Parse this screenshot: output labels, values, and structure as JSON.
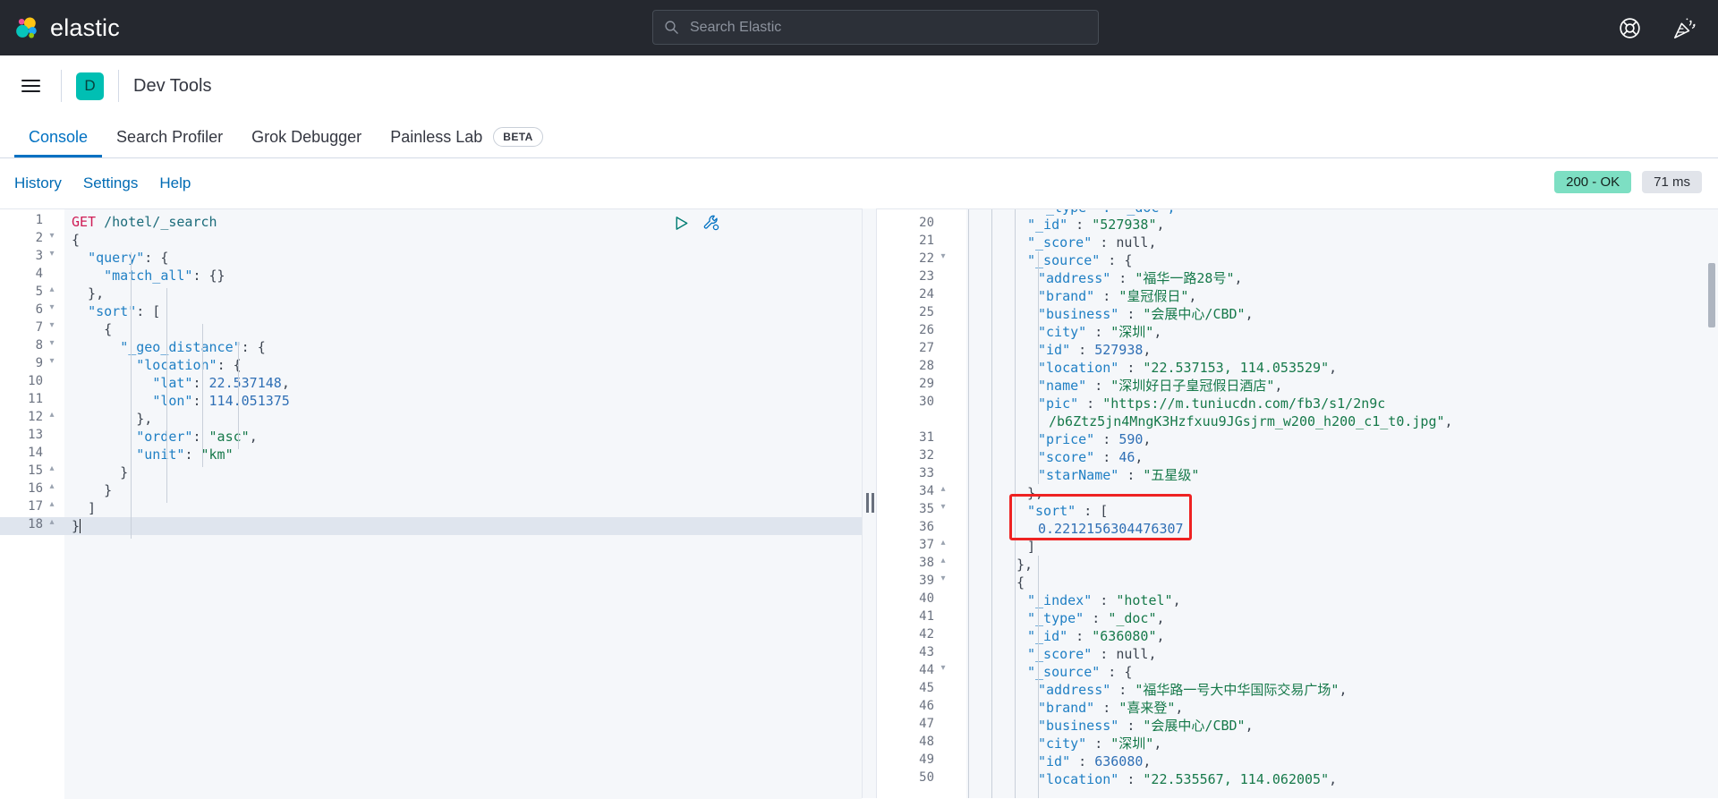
{
  "header": {
    "brand_name": "elastic",
    "search": {
      "placeholder": "Search Elastic",
      "value": "",
      "icon": "search-icon"
    },
    "icons": [
      {
        "name": "help-lifebuoy-icon",
        "label": "Help"
      },
      {
        "name": "news-confetti-icon",
        "label": "News"
      }
    ]
  },
  "breadcrumb": {
    "menu_icon": "hamburger-menu-icon",
    "space_initial": "D",
    "title": "Dev Tools"
  },
  "tabs": [
    {
      "label": "Console",
      "active": true,
      "badge": ""
    },
    {
      "label": "Search Profiler",
      "active": false,
      "badge": ""
    },
    {
      "label": "Grok Debugger",
      "active": false,
      "badge": ""
    },
    {
      "label": "Painless Lab",
      "active": false,
      "badge": "BETA"
    }
  ],
  "subbar": {
    "links": [
      "History",
      "Settings",
      "Help"
    ],
    "status_badge": "200 - OK",
    "time_badge": "71 ms",
    "status_color": "#7ddfc3",
    "time_color": "#e1e4ea"
  },
  "editor_actions": [
    {
      "name": "send-request-play-icon",
      "label": "Click to send request"
    },
    {
      "name": "wrench-menu-icon",
      "label": "Open documentation / auto indent"
    }
  ],
  "request_editor": {
    "active_line": 18,
    "lines": [
      {
        "n": 1,
        "fold": "",
        "indent": 0,
        "tokens": [
          {
            "t": "GET",
            "c": "k-method"
          },
          {
            "t": " ",
            "c": "k-punc"
          },
          {
            "t": "/hotel/_search",
            "c": "k-url"
          }
        ]
      },
      {
        "n": 2,
        "fold": "▾",
        "indent": 0,
        "tokens": [
          {
            "t": "{",
            "c": "k-punc"
          }
        ]
      },
      {
        "n": 3,
        "fold": "▾",
        "indent": 1,
        "tokens": [
          {
            "t": "  ",
            "c": "k-punc"
          },
          {
            "t": "\"query\"",
            "c": "k-key"
          },
          {
            "t": ": {",
            "c": "k-punc"
          }
        ]
      },
      {
        "n": 4,
        "fold": "",
        "indent": 2,
        "tokens": [
          {
            "t": "    ",
            "c": "k-punc"
          },
          {
            "t": "\"match_all\"",
            "c": "k-key"
          },
          {
            "t": ": {}",
            "c": "k-punc"
          }
        ]
      },
      {
        "n": 5,
        "fold": "▴",
        "indent": 1,
        "tokens": [
          {
            "t": "  },",
            "c": "k-punc"
          }
        ]
      },
      {
        "n": 6,
        "fold": "▾",
        "indent": 1,
        "tokens": [
          {
            "t": "  ",
            "c": "k-punc"
          },
          {
            "t": "\"sort\"",
            "c": "k-key"
          },
          {
            "t": ": [",
            "c": "k-punc"
          }
        ]
      },
      {
        "n": 7,
        "fold": "▾",
        "indent": 2,
        "tokens": [
          {
            "t": "    {",
            "c": "k-punc"
          }
        ]
      },
      {
        "n": 8,
        "fold": "▾",
        "indent": 3,
        "tokens": [
          {
            "t": "      ",
            "c": "k-punc"
          },
          {
            "t": "\"_geo_distance\"",
            "c": "k-key"
          },
          {
            "t": ": {",
            "c": "k-punc"
          }
        ]
      },
      {
        "n": 9,
        "fold": "▾",
        "indent": 4,
        "tokens": [
          {
            "t": "        ",
            "c": "k-punc"
          },
          {
            "t": "\"location\"",
            "c": "k-key"
          },
          {
            "t": ": {",
            "c": "k-punc"
          }
        ]
      },
      {
        "n": 10,
        "fold": "",
        "indent": 5,
        "tokens": [
          {
            "t": "          ",
            "c": "k-punc"
          },
          {
            "t": "\"lat\"",
            "c": "k-key"
          },
          {
            "t": ": ",
            "c": "k-punc"
          },
          {
            "t": "22.537148",
            "c": "k-num"
          },
          {
            "t": ",",
            "c": "k-punc"
          }
        ]
      },
      {
        "n": 11,
        "fold": "",
        "indent": 5,
        "tokens": [
          {
            "t": "          ",
            "c": "k-punc"
          },
          {
            "t": "\"lon\"",
            "c": "k-key"
          },
          {
            "t": ": ",
            "c": "k-punc"
          },
          {
            "t": "114.051375",
            "c": "k-num"
          }
        ]
      },
      {
        "n": 12,
        "fold": "▴",
        "indent": 4,
        "tokens": [
          {
            "t": "        },",
            "c": "k-punc"
          }
        ]
      },
      {
        "n": 13,
        "fold": "",
        "indent": 4,
        "tokens": [
          {
            "t": "        ",
            "c": "k-punc"
          },
          {
            "t": "\"order\"",
            "c": "k-key"
          },
          {
            "t": ": ",
            "c": "k-punc"
          },
          {
            "t": "\"asc\"",
            "c": "k-str"
          },
          {
            "t": ",",
            "c": "k-punc"
          }
        ]
      },
      {
        "n": 14,
        "fold": "",
        "indent": 4,
        "tokens": [
          {
            "t": "        ",
            "c": "k-punc"
          },
          {
            "t": "\"unit\"",
            "c": "k-key"
          },
          {
            "t": ": ",
            "c": "k-punc"
          },
          {
            "t": "\"km\"",
            "c": "k-str"
          }
        ]
      },
      {
        "n": 15,
        "fold": "▴",
        "indent": 3,
        "tokens": [
          {
            "t": "      }",
            "c": "k-punc"
          }
        ]
      },
      {
        "n": 16,
        "fold": "▴",
        "indent": 2,
        "tokens": [
          {
            "t": "    }",
            "c": "k-punc"
          }
        ]
      },
      {
        "n": 17,
        "fold": "▴",
        "indent": 1,
        "tokens": [
          {
            "t": "  ]",
            "c": "k-punc"
          }
        ]
      },
      {
        "n": 18,
        "fold": "▴",
        "indent": 0,
        "tokens": [
          {
            "t": "}",
            "c": "k-punc"
          }
        ]
      }
    ]
  },
  "response_viewer": {
    "scroll_clipped_top_line": "\"_type\" : \"_doc\",",
    "lines": [
      {
        "n": 20,
        "fold": "",
        "indent": 4,
        "tokens": [
          {
            "t": "\"_id\"",
            "c": "k-key"
          },
          {
            "t": " : ",
            "c": "k-punc"
          },
          {
            "t": "\"527938\"",
            "c": "k-str"
          },
          {
            "t": ",",
            "c": "k-punc"
          }
        ]
      },
      {
        "n": 21,
        "fold": "",
        "indent": 4,
        "tokens": [
          {
            "t": "\"_score\"",
            "c": "k-key"
          },
          {
            "t": " : ",
            "c": "k-punc"
          },
          {
            "t": "null",
            "c": "k-null"
          },
          {
            "t": ",",
            "c": "k-punc"
          }
        ]
      },
      {
        "n": 22,
        "fold": "▾",
        "indent": 4,
        "tokens": [
          {
            "t": "\"_source\"",
            "c": "k-key"
          },
          {
            "t": " : {",
            "c": "k-punc"
          }
        ]
      },
      {
        "n": 23,
        "fold": "",
        "indent": 5,
        "tokens": [
          {
            "t": "\"address\"",
            "c": "k-key"
          },
          {
            "t": " : ",
            "c": "k-punc"
          },
          {
            "t": "\"福华一路28号\"",
            "c": "k-str"
          },
          {
            "t": ",",
            "c": "k-punc"
          }
        ]
      },
      {
        "n": 24,
        "fold": "",
        "indent": 5,
        "tokens": [
          {
            "t": "\"brand\"",
            "c": "k-key"
          },
          {
            "t": " : ",
            "c": "k-punc"
          },
          {
            "t": "\"皇冠假日\"",
            "c": "k-str"
          },
          {
            "t": ",",
            "c": "k-punc"
          }
        ]
      },
      {
        "n": 25,
        "fold": "",
        "indent": 5,
        "tokens": [
          {
            "t": "\"business\"",
            "c": "k-key"
          },
          {
            "t": " : ",
            "c": "k-punc"
          },
          {
            "t": "\"会展中心/CBD\"",
            "c": "k-str"
          },
          {
            "t": ",",
            "c": "k-punc"
          }
        ]
      },
      {
        "n": 26,
        "fold": "",
        "indent": 5,
        "tokens": [
          {
            "t": "\"city\"",
            "c": "k-key"
          },
          {
            "t": " : ",
            "c": "k-punc"
          },
          {
            "t": "\"深圳\"",
            "c": "k-str"
          },
          {
            "t": ",",
            "c": "k-punc"
          }
        ]
      },
      {
        "n": 27,
        "fold": "",
        "indent": 5,
        "tokens": [
          {
            "t": "\"id\"",
            "c": "k-key"
          },
          {
            "t": " : ",
            "c": "k-punc"
          },
          {
            "t": "527938",
            "c": "k-num"
          },
          {
            "t": ",",
            "c": "k-punc"
          }
        ]
      },
      {
        "n": 28,
        "fold": "",
        "indent": 5,
        "tokens": [
          {
            "t": "\"location\"",
            "c": "k-key"
          },
          {
            "t": " : ",
            "c": "k-punc"
          },
          {
            "t": "\"22.537153, 114.053529\"",
            "c": "k-str"
          },
          {
            "t": ",",
            "c": "k-punc"
          }
        ]
      },
      {
        "n": 29,
        "fold": "",
        "indent": 5,
        "tokens": [
          {
            "t": "\"name\"",
            "c": "k-key"
          },
          {
            "t": " : ",
            "c": "k-punc"
          },
          {
            "t": "\"深圳好日子皇冠假日酒店\"",
            "c": "k-str"
          },
          {
            "t": ",",
            "c": "k-punc"
          }
        ]
      },
      {
        "n": 30,
        "fold": "",
        "indent": 5,
        "tokens": [
          {
            "t": "\"pic\"",
            "c": "k-key"
          },
          {
            "t": " : ",
            "c": "k-punc"
          },
          {
            "t": "\"https://m.tuniucdn.com/fb3/s1/2n9c",
            "c": "k-str"
          }
        ]
      },
      {
        "n": "",
        "fold": "",
        "indent": 6,
        "wrap": true,
        "tokens": [
          {
            "t": "/b6Ztz5jn4MngK3Hzfxuu9JGsjrm_w200_h200_c1_t0.jpg\"",
            "c": "k-str"
          },
          {
            "t": ",",
            "c": "k-punc"
          }
        ]
      },
      {
        "n": 31,
        "fold": "",
        "indent": 5,
        "tokens": [
          {
            "t": "\"price\"",
            "c": "k-key"
          },
          {
            "t": " : ",
            "c": "k-punc"
          },
          {
            "t": "590",
            "c": "k-num"
          },
          {
            "t": ",",
            "c": "k-punc"
          }
        ]
      },
      {
        "n": 32,
        "fold": "",
        "indent": 5,
        "tokens": [
          {
            "t": "\"score\"",
            "c": "k-key"
          },
          {
            "t": " : ",
            "c": "k-punc"
          },
          {
            "t": "46",
            "c": "k-num"
          },
          {
            "t": ",",
            "c": "k-punc"
          }
        ]
      },
      {
        "n": 33,
        "fold": "",
        "indent": 5,
        "tokens": [
          {
            "t": "\"starName\"",
            "c": "k-key"
          },
          {
            "t": " : ",
            "c": "k-punc"
          },
          {
            "t": "\"五星级\"",
            "c": "k-str"
          }
        ]
      },
      {
        "n": 34,
        "fold": "▴",
        "indent": 4,
        "tokens": [
          {
            "t": "},",
            "c": "k-punc"
          }
        ]
      },
      {
        "n": 35,
        "fold": "▾",
        "indent": 4,
        "tokens": [
          {
            "t": "\"sort\"",
            "c": "k-key"
          },
          {
            "t": " : [",
            "c": "k-punc"
          }
        ]
      },
      {
        "n": 36,
        "fold": "",
        "indent": 5,
        "tokens": [
          {
            "t": "0.2212156304476307",
            "c": "k-num"
          }
        ]
      },
      {
        "n": 37,
        "fold": "▴",
        "indent": 4,
        "tokens": [
          {
            "t": "]",
            "c": "k-punc"
          }
        ]
      },
      {
        "n": 38,
        "fold": "▴",
        "indent": 3,
        "tokens": [
          {
            "t": "},",
            "c": "k-punc"
          }
        ]
      },
      {
        "n": 39,
        "fold": "▾",
        "indent": 3,
        "tokens": [
          {
            "t": "{",
            "c": "k-punc"
          }
        ]
      },
      {
        "n": 40,
        "fold": "",
        "indent": 4,
        "tokens": [
          {
            "t": "\"_index\"",
            "c": "k-key"
          },
          {
            "t": " : ",
            "c": "k-punc"
          },
          {
            "t": "\"hotel\"",
            "c": "k-str"
          },
          {
            "t": ",",
            "c": "k-punc"
          }
        ]
      },
      {
        "n": 41,
        "fold": "",
        "indent": 4,
        "tokens": [
          {
            "t": "\"_type\"",
            "c": "k-key"
          },
          {
            "t": " : ",
            "c": "k-punc"
          },
          {
            "t": "\"_doc\"",
            "c": "k-str"
          },
          {
            "t": ",",
            "c": "k-punc"
          }
        ]
      },
      {
        "n": 42,
        "fold": "",
        "indent": 4,
        "tokens": [
          {
            "t": "\"_id\"",
            "c": "k-key"
          },
          {
            "t": " : ",
            "c": "k-punc"
          },
          {
            "t": "\"636080\"",
            "c": "k-str"
          },
          {
            "t": ",",
            "c": "k-punc"
          }
        ]
      },
      {
        "n": 43,
        "fold": "",
        "indent": 4,
        "tokens": [
          {
            "t": "\"_score\"",
            "c": "k-key"
          },
          {
            "t": " : ",
            "c": "k-punc"
          },
          {
            "t": "null",
            "c": "k-null"
          },
          {
            "t": ",",
            "c": "k-punc"
          }
        ]
      },
      {
        "n": 44,
        "fold": "▾",
        "indent": 4,
        "tokens": [
          {
            "t": "\"_source\"",
            "c": "k-key"
          },
          {
            "t": " : {",
            "c": "k-punc"
          }
        ]
      },
      {
        "n": 45,
        "fold": "",
        "indent": 5,
        "tokens": [
          {
            "t": "\"address\"",
            "c": "k-key"
          },
          {
            "t": " : ",
            "c": "k-punc"
          },
          {
            "t": "\"福华路一号大中华国际交易广场\"",
            "c": "k-str"
          },
          {
            "t": ",",
            "c": "k-punc"
          }
        ]
      },
      {
        "n": 46,
        "fold": "",
        "indent": 5,
        "tokens": [
          {
            "t": "\"brand\"",
            "c": "k-key"
          },
          {
            "t": " : ",
            "c": "k-punc"
          },
          {
            "t": "\"喜来登\"",
            "c": "k-str"
          },
          {
            "t": ",",
            "c": "k-punc"
          }
        ]
      },
      {
        "n": 47,
        "fold": "",
        "indent": 5,
        "tokens": [
          {
            "t": "\"business\"",
            "c": "k-key"
          },
          {
            "t": " : ",
            "c": "k-punc"
          },
          {
            "t": "\"会展中心/CBD\"",
            "c": "k-str"
          },
          {
            "t": ",",
            "c": "k-punc"
          }
        ]
      },
      {
        "n": 48,
        "fold": "",
        "indent": 5,
        "tokens": [
          {
            "t": "\"city\"",
            "c": "k-key"
          },
          {
            "t": " : ",
            "c": "k-punc"
          },
          {
            "t": "\"深圳\"",
            "c": "k-str"
          },
          {
            "t": ",",
            "c": "k-punc"
          }
        ]
      },
      {
        "n": 49,
        "fold": "",
        "indent": 5,
        "tokens": [
          {
            "t": "\"id\"",
            "c": "k-key"
          },
          {
            "t": " : ",
            "c": "k-punc"
          },
          {
            "t": "636080",
            "c": "k-num"
          },
          {
            "t": ",",
            "c": "k-punc"
          }
        ]
      },
      {
        "n": 50,
        "fold": "",
        "indent": 5,
        "tokens": [
          {
            "t": "\"location\"",
            "c": "k-key"
          },
          {
            "t": " : ",
            "c": "k-punc"
          },
          {
            "t": "\"22.535567, 114.062005\"",
            "c": "k-str"
          },
          {
            "t": ",",
            "c": "k-punc"
          }
        ]
      }
    ],
    "annotation": {
      "type": "red-rectangle-highlight",
      "color": "#ee2222",
      "covers_lines": [
        35,
        36,
        37
      ],
      "highlighted_value": "0.2212156304476307"
    }
  }
}
